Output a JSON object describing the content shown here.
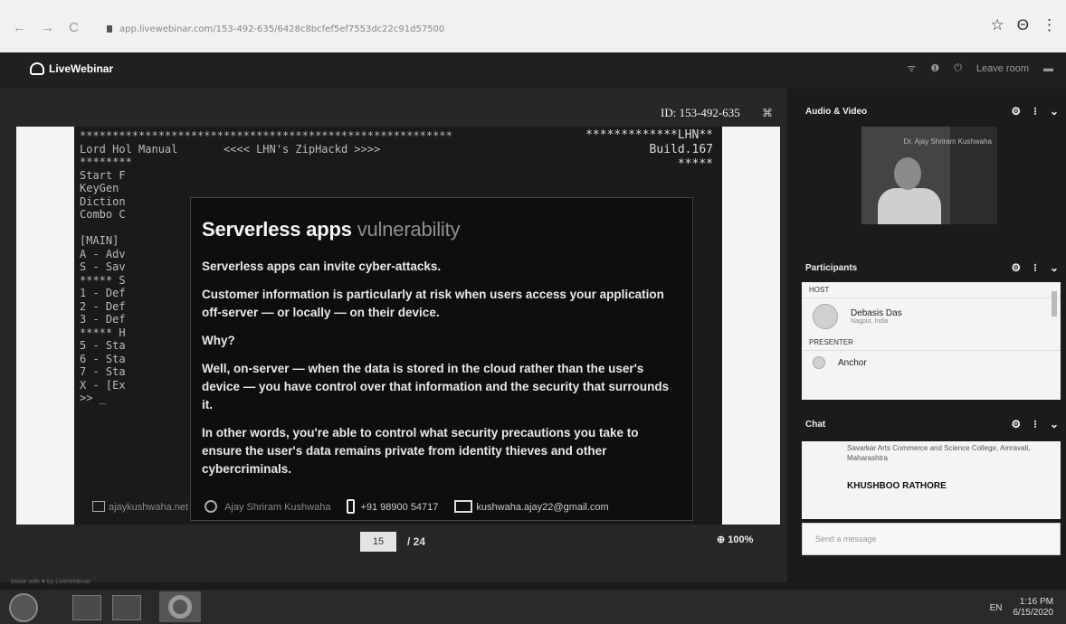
{
  "browser": {
    "back": "←",
    "forward": "→",
    "reload": "C",
    "url": "app.livewebinar.com/153-492-635/6428c8bcfef5ef7553dc22c91d57500",
    "star": "☆",
    "account": "Θ",
    "menu": "⋮"
  },
  "app": {
    "brand": "LiveWebinar",
    "header_ctrls": [
      "ᯤ",
      "❶",
      "⏻",
      "Leave room",
      "▬"
    ],
    "made_with": "Made with ♥ by LiveWebinar"
  },
  "stage": {
    "meeting_id": "ID: 153-492-635",
    "expand_icon": "⌘",
    "console": {
      "header_right": [
        "*************LHN**",
        "Build.167",
        "*****"
      ],
      "lines": [
        "*********************************************************",
        "Lord Hol Manual       <<<< LHN's ZipHackd >>>>",
        "********",
        "Start F",
        "KeyGen",
        "Diction",
        "Combo C",
        "",
        "[MAIN]",
        "A - Adv",
        "S - Sav",
        "***** S",
        "1 - Def",
        "2 - Def",
        "3 - Def",
        "***** H",
        "5 - Sta",
        "6 - Sta",
        "7 - Sta",
        "X - [Ex",
        ">> _"
      ]
    },
    "slide": {
      "title_main": "Serverless apps",
      "title_muted": "vulnerability",
      "paragraphs": [
        "Serverless apps can invite cyber-attacks.",
        "Customer information is particularly at risk when users access your application off-server — or locally — on their device.",
        "Why?",
        "Well, on-server — when the data is stored in the cloud rather than the user's device — you have control over that information and the security that surrounds it.",
        "In other words, you're able to control what security precautions you take to ensure the user's data remains private from identity thieves and other cybercriminals."
      ]
    },
    "footer": {
      "website": "ajaykushwaha.net",
      "name": "Ajay Shriram Kushwaha",
      "phone": "+91 98900 54717",
      "email": "kushwaha.ajay22@gmail.com"
    },
    "pager": {
      "current": "15",
      "total": "/ 24"
    },
    "zoom": "100%",
    "zoom_icon": "⊕"
  },
  "panel": {
    "audio_video": {
      "title": "Audio & Video",
      "presenter_label": "Dr. Ajay Shriram Kushwaha"
    },
    "participants": {
      "title": "Participants",
      "host_label": "HOST",
      "host_name": "Debasis Das",
      "host_sub": "Nagpur, India",
      "presenter_label": "PRESENTER",
      "presenter_name": "Anchor"
    },
    "chat": {
      "title": "Chat",
      "prev_message": "Savarkar Arts Commerce and Science College, Amravati, Maharashtra",
      "author": "KHUSHBOO RATHORE",
      "input_placeholder": "Send a message"
    },
    "ctrl_gear": "⚙",
    "ctrl_more": "⁝",
    "ctrl_collapse": "⌄"
  },
  "taskbar": {
    "lang": "EN",
    "time": "1:16 PM",
    "date": "6/15/2020"
  }
}
